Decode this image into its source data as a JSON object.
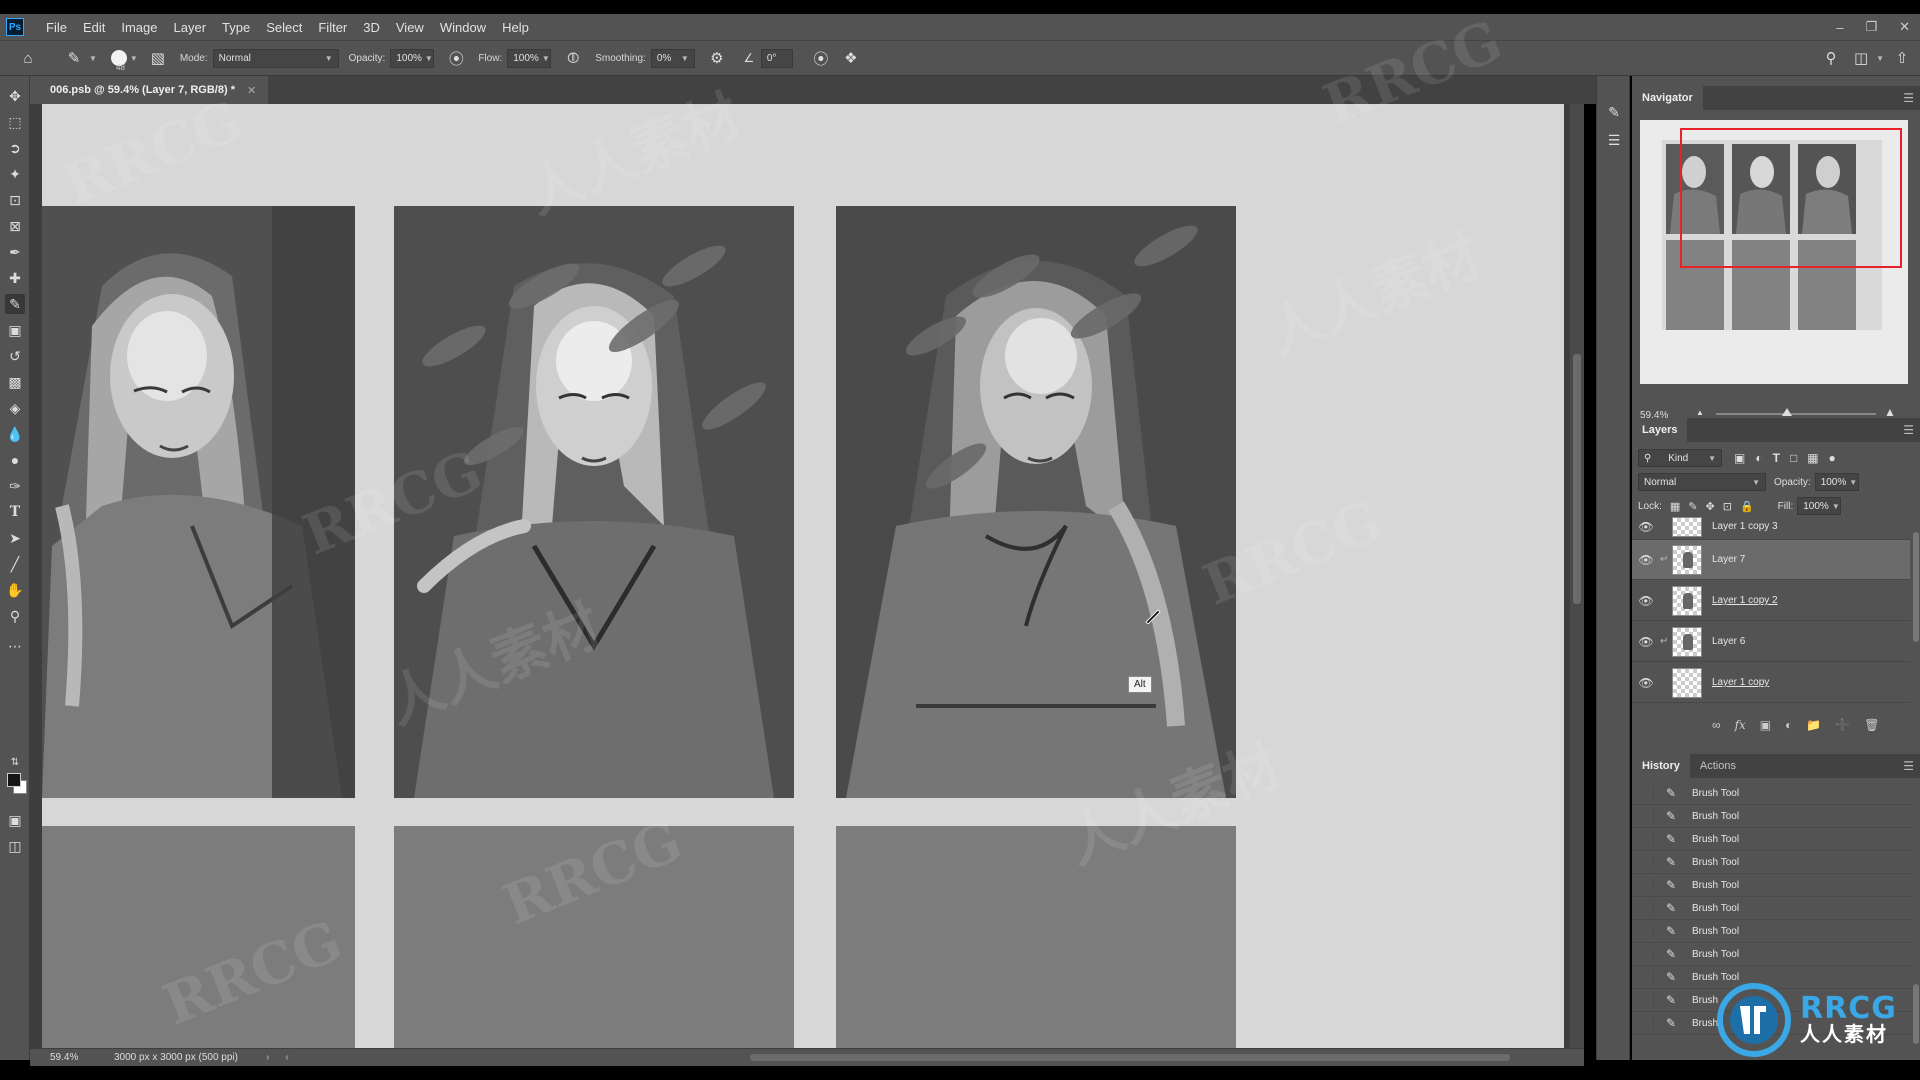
{
  "app": {
    "logo": "Ps",
    "menu": [
      "File",
      "Edit",
      "Image",
      "Layer",
      "Type",
      "Select",
      "Filter",
      "3D",
      "View",
      "Window",
      "Help"
    ],
    "window_controls": [
      "minimize-icon",
      "restore-icon",
      "close-icon"
    ]
  },
  "options_bar": {
    "brush_size": "48",
    "mode_label": "Mode:",
    "mode_value": "Normal",
    "opacity_label": "Opacity:",
    "opacity_value": "100%",
    "flow_label": "Flow:",
    "flow_value": "100%",
    "smoothing_label": "Smoothing:",
    "smoothing_value": "0%",
    "angle_value": "0°"
  },
  "document": {
    "tab_title": "006.psb @ 59.4% (Layer 7, RGB/8) *",
    "zoom": "59.4%",
    "info": "3000 px x 3000 px (500 ppi)"
  },
  "canvas": {
    "background": "#d7d7d7",
    "panels_painted": 3,
    "panels_empty": 3,
    "tooltip": "Alt"
  },
  "navigator": {
    "title": "Navigator",
    "zoom": "59.4%",
    "view_rect_color": "#e8222a"
  },
  "layers": {
    "title": "Layers",
    "filter_kind": "Kind",
    "blend_mode": "Normal",
    "opacity_label": "Opacity:",
    "opacity_value": "100%",
    "lock_label": "Lock:",
    "fill_label": "Fill:",
    "fill_value": "100%",
    "items": [
      {
        "name": "Layer 1 copy 3",
        "clipped": false,
        "selected": false,
        "visible": true
      },
      {
        "name": "Layer 7",
        "clipped": true,
        "selected": true,
        "visible": true
      },
      {
        "name": "Layer 1 copy 2",
        "clipped": false,
        "selected": false,
        "visible": true
      },
      {
        "name": "Layer 6",
        "clipped": true,
        "selected": false,
        "visible": true
      },
      {
        "name": "Layer 1 copy",
        "clipped": false,
        "selected": false,
        "visible": true
      }
    ]
  },
  "history": {
    "tabs": [
      "History",
      "Actions"
    ],
    "items": [
      "Brush Tool",
      "Brush Tool",
      "Brush Tool",
      "Brush Tool",
      "Brush Tool",
      "Brush Tool",
      "Brush Tool",
      "Brush Tool",
      "Brush Tool",
      "Brush",
      "Brush"
    ]
  },
  "watermark": {
    "logo_text": "RRCG",
    "logo_subtext": "人人素材",
    "overlay_texts": [
      "RRCG",
      "人人素材"
    ],
    "brand_color": "#3aa7e6"
  }
}
